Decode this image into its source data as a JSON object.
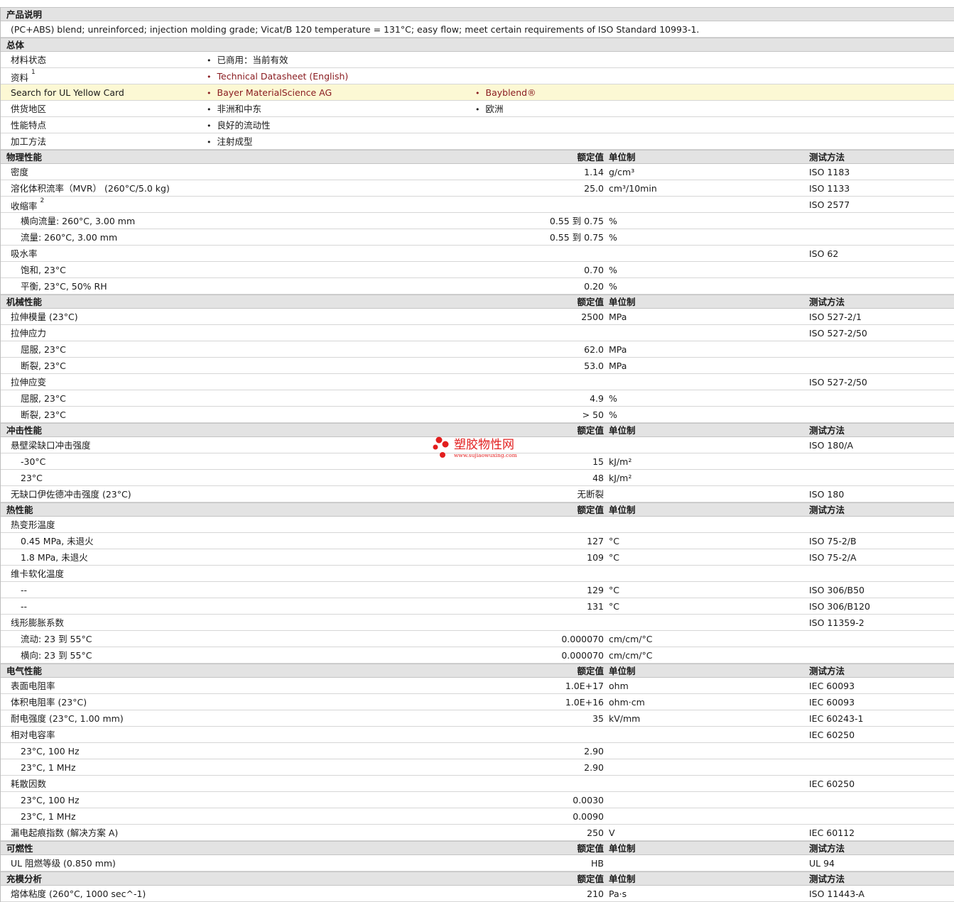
{
  "product_description": {
    "header": "产品说明",
    "text": "(PC+ABS) blend; unreinforced; injection molding grade; Vicat/B 120 temperature = 131°C; easy flow; meet certain requirements of ISO Standard 10993-1."
  },
  "general": {
    "header": "总体",
    "rows": [
      {
        "label": "材料状态",
        "sup": "",
        "items": [
          "已商用：当前有效"
        ],
        "links": false,
        "highlight": false
      },
      {
        "label": "资料",
        "sup": "1",
        "items": [
          "Technical Datasheet (English)"
        ],
        "links": true,
        "highlight": false
      },
      {
        "label": "Search for UL Yellow Card",
        "sup": "",
        "items": [
          "Bayer MaterialScience AG",
          "Bayblend®"
        ],
        "links": true,
        "highlight": true
      },
      {
        "label": "供货地区",
        "sup": "",
        "items": [
          "非洲和中东",
          "欧洲"
        ],
        "links": false,
        "highlight": false
      },
      {
        "label": "性能特点",
        "sup": "",
        "items": [
          "良好的流动性"
        ],
        "links": false,
        "highlight": false
      },
      {
        "label": "加工方法",
        "sup": "",
        "items": [
          "注射成型"
        ],
        "links": false,
        "highlight": false
      }
    ]
  },
  "columns": {
    "value": "额定值",
    "unit": "单位制",
    "method": "测试方法"
  },
  "sections": [
    {
      "title": "物理性能",
      "rows": [
        {
          "label": "密度",
          "value": "1.14",
          "unit": "g/cm³",
          "method": "ISO 1183"
        },
        {
          "label": "溶化体积流率（MVR） (260°C/5.0 kg)",
          "value": "25.0",
          "unit": "cm³/10min",
          "method": "ISO 1133"
        },
        {
          "label": "收缩率",
          "sup": "2",
          "value": "",
          "unit": "",
          "method": "ISO 2577"
        },
        {
          "label": "横向流量: 260°C, 3.00 mm",
          "sub": true,
          "value": "0.55 到  0.75",
          "unit": "%",
          "method": ""
        },
        {
          "label": "流量: 260°C, 3.00 mm",
          "sub": true,
          "value": "0.55 到  0.75",
          "unit": "%",
          "method": ""
        },
        {
          "label": "吸水率",
          "value": "",
          "unit": "",
          "method": "ISO 62"
        },
        {
          "label": "饱和, 23°C",
          "sub": true,
          "value": "0.70",
          "unit": "%",
          "method": ""
        },
        {
          "label": "平衡, 23°C, 50% RH",
          "sub": true,
          "value": "0.20",
          "unit": "%",
          "method": ""
        }
      ]
    },
    {
      "title": "机械性能",
      "rows": [
        {
          "label": "拉伸模量 (23°C)",
          "value": "2500",
          "unit": "MPa",
          "method": "ISO 527-2/1"
        },
        {
          "label": "拉伸应力",
          "value": "",
          "unit": "",
          "method": "ISO 527-2/50"
        },
        {
          "label": "屈服, 23°C",
          "sub": true,
          "value": "62.0",
          "unit": "MPa",
          "method": ""
        },
        {
          "label": "断裂, 23°C",
          "sub": true,
          "value": "53.0",
          "unit": "MPa",
          "method": ""
        },
        {
          "label": "拉伸应变",
          "value": "",
          "unit": "",
          "method": "ISO 527-2/50"
        },
        {
          "label": "屈服, 23°C",
          "sub": true,
          "value": "4.9",
          "unit": "%",
          "method": ""
        },
        {
          "label": "断裂, 23°C",
          "sub": true,
          "value": "> 50",
          "unit": "%",
          "method": ""
        }
      ]
    },
    {
      "title": "冲击性能",
      "rows": [
        {
          "label": "悬壁梁缺口冲击强度",
          "value": "",
          "unit": "",
          "method": "ISO 180/A"
        },
        {
          "label": "-30°C",
          "sub": true,
          "value": "15",
          "unit": "kJ/m²",
          "method": ""
        },
        {
          "label": "23°C",
          "sub": true,
          "value": "48",
          "unit": "kJ/m²",
          "method": ""
        },
        {
          "label": "无缺口伊佐德冲击强度 (23°C)",
          "value": "无断裂",
          "unit": "",
          "method": "ISO 180"
        }
      ]
    },
    {
      "title": "热性能",
      "rows": [
        {
          "label": "热变形温度",
          "value": "",
          "unit": "",
          "method": ""
        },
        {
          "label": "0.45 MPa, 未退火",
          "sub": true,
          "value": "127",
          "unit": "°C",
          "method": "ISO 75-2/B"
        },
        {
          "label": "1.8 MPa, 未退火",
          "sub": true,
          "value": "109",
          "unit": "°C",
          "method": "ISO 75-2/A"
        },
        {
          "label": "维卡软化温度",
          "value": "",
          "unit": "",
          "method": ""
        },
        {
          "label": "--",
          "sub": true,
          "value": "129",
          "unit": "°C",
          "method": "ISO 306/B50"
        },
        {
          "label": "--",
          "sub": true,
          "value": "131",
          "unit": "°C",
          "method": "ISO 306/B120"
        },
        {
          "label": "线形膨胀系数",
          "value": "",
          "unit": "",
          "method": "ISO 11359-2"
        },
        {
          "label": "流动: 23 到  55°C",
          "sub": true,
          "value": "0.000070",
          "unit": "cm/cm/°C",
          "method": ""
        },
        {
          "label": "横向: 23 到  55°C",
          "sub": true,
          "value": "0.000070",
          "unit": "cm/cm/°C",
          "method": ""
        }
      ]
    },
    {
      "title": "电气性能",
      "rows": [
        {
          "label": "表面电阻率",
          "value": "1.0E+17",
          "unit": "ohm",
          "method": "IEC 60093"
        },
        {
          "label": "体积电阻率 (23°C)",
          "value": "1.0E+16",
          "unit": "ohm·cm",
          "method": "IEC 60093"
        },
        {
          "label": "耐电强度 (23°C, 1.00 mm)",
          "value": "35",
          "unit": "kV/mm",
          "method": "IEC 60243-1"
        },
        {
          "label": "相对电容率",
          "value": "",
          "unit": "",
          "method": "IEC 60250"
        },
        {
          "label": "23°C, 100 Hz",
          "sub": true,
          "value": "2.90",
          "unit": "",
          "method": ""
        },
        {
          "label": "23°C, 1 MHz",
          "sub": true,
          "value": "2.90",
          "unit": "",
          "method": ""
        },
        {
          "label": "耗散因数",
          "value": "",
          "unit": "",
          "method": "IEC 60250"
        },
        {
          "label": "23°C, 100 Hz",
          "sub": true,
          "value": "0.0030",
          "unit": "",
          "method": ""
        },
        {
          "label": "23°C, 1 MHz",
          "sub": true,
          "value": "0.0090",
          "unit": "",
          "method": ""
        },
        {
          "label": "漏电起痕指数 (解决方案 A)",
          "value": "250",
          "unit": "V",
          "method": "IEC 60112"
        }
      ]
    },
    {
      "title": "可燃性",
      "rows": [
        {
          "label": "UL 阻燃等级 (0.850 mm)",
          "value": "HB",
          "unit": "",
          "method": "UL 94"
        }
      ]
    },
    {
      "title": "充模分析",
      "rows": [
        {
          "label": "熔体粘度 (260°C, 1000 sec^-1)",
          "value": "210",
          "unit": "Pa·s",
          "method": "ISO 11443-A"
        }
      ]
    }
  ],
  "watermark": {
    "text": "塑胶物性网",
    "url": "www.sujiaowuxing.com",
    "color": "#e21e1e"
  }
}
